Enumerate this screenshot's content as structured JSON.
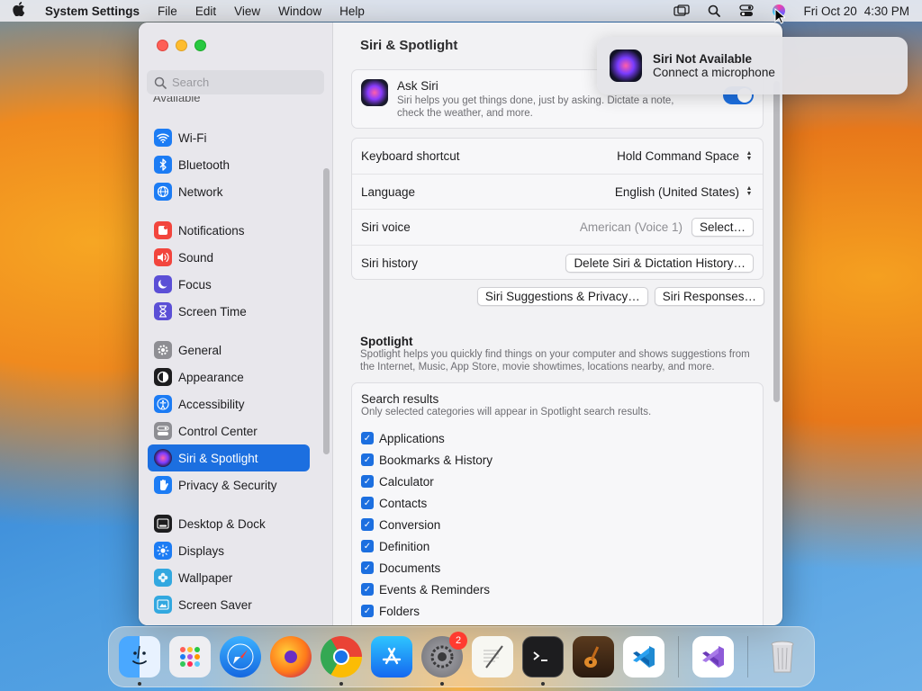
{
  "menubar": {
    "app_name": "System Settings",
    "menus": [
      "File",
      "Edit",
      "View",
      "Window",
      "Help"
    ],
    "date": "Fri Oct 20",
    "time": "4:30 PM"
  },
  "sidebar": {
    "search_placeholder": "Search",
    "cut_label": "Available",
    "items": [
      {
        "label": "Wi-Fi",
        "icon": "wifi-icon",
        "color": "#1c7cf4"
      },
      {
        "label": "Bluetooth",
        "icon": "bluetooth-icon",
        "color": "#1c7cf4"
      },
      {
        "label": "Network",
        "icon": "globe-icon",
        "color": "#1c7cf4"
      },
      {
        "label": "Notifications",
        "icon": "bell-icon",
        "color": "#f2453d"
      },
      {
        "label": "Sound",
        "icon": "speaker-icon",
        "color": "#f2453d"
      },
      {
        "label": "Focus",
        "icon": "moon-icon",
        "color": "#5b4fd6"
      },
      {
        "label": "Screen Time",
        "icon": "hourglass-icon",
        "color": "#5b4fd6"
      },
      {
        "label": "General",
        "icon": "gear-icon",
        "color": "#8e8e93"
      },
      {
        "label": "Appearance",
        "icon": "appearance-icon",
        "color": "#1d1d1f"
      },
      {
        "label": "Accessibility",
        "icon": "accessibility-icon",
        "color": "#1c7cf4"
      },
      {
        "label": "Control Center",
        "icon": "control-center-icon",
        "color": "#8e8e93"
      },
      {
        "label": "Siri & Spotlight",
        "icon": "siri-icon",
        "color": "#2a1b4a"
      },
      {
        "label": "Privacy & Security",
        "icon": "hand-icon",
        "color": "#1c7cf4"
      },
      {
        "label": "Desktop & Dock",
        "icon": "dock-icon",
        "color": "#1d1d1f"
      },
      {
        "label": "Displays",
        "icon": "sun-icon",
        "color": "#1c7cf4"
      },
      {
        "label": "Wallpaper",
        "icon": "flower-icon",
        "color": "#32a8e0"
      },
      {
        "label": "Screen Saver",
        "icon": "screensaver-icon",
        "color": "#32a8e0"
      }
    ]
  },
  "main": {
    "title": "Siri & Spotlight",
    "ask_siri": {
      "label": "Ask Siri",
      "description": "Siri helps you get things done, just by asking. Dictate a note, check the weather, and more.",
      "enabled": true
    },
    "keyboard_shortcut": {
      "label": "Keyboard shortcut",
      "value": "Hold Command Space"
    },
    "language": {
      "label": "Language",
      "value": "English (United States)"
    },
    "siri_voice": {
      "label": "Siri voice",
      "value": "American (Voice 1)",
      "button": "Select…"
    },
    "siri_history": {
      "label": "Siri history",
      "button": "Delete Siri & Dictation History…"
    },
    "suggestions_button": "Siri Suggestions & Privacy…",
    "responses_button": "Siri Responses…",
    "spotlight": {
      "title": "Spotlight",
      "description": "Spotlight helps you quickly find things on your computer and shows suggestions from the Internet, Music, App Store, movie showtimes, locations nearby, and more."
    },
    "search_results": {
      "title": "Search results",
      "description": "Only selected categories will appear in Spotlight search results.",
      "items": [
        "Applications",
        "Bookmarks & History",
        "Calculator",
        "Contacts",
        "Conversion",
        "Definition",
        "Documents",
        "Events & Reminders",
        "Folders"
      ]
    }
  },
  "notification": {
    "title": "Siri Not Available",
    "subtitle": "Connect a microphone"
  },
  "dock": {
    "apps": [
      {
        "name": "finder-icon",
        "color": "#2a8cf0",
        "running": true
      },
      {
        "name": "launchpad-icon",
        "color": "#e8e8ee",
        "running": false
      },
      {
        "name": "safari-icon",
        "color": "#1a8af0",
        "running": false
      },
      {
        "name": "firefox-icon",
        "color": "#ff7a1a",
        "running": false
      },
      {
        "name": "chrome-icon",
        "color": "#ffffff",
        "running": true
      },
      {
        "name": "app-store-icon",
        "color": "#1a8cf0",
        "running": false
      },
      {
        "name": "system-settings-icon",
        "color": "#8e8e93",
        "running": true,
        "badge": "2"
      },
      {
        "name": "textedit-icon",
        "color": "#f5f5f5",
        "running": false
      },
      {
        "name": "terminal-icon",
        "color": "#1d1d1f",
        "running": true
      },
      {
        "name": "garageband-icon",
        "color": "#3a2a1a",
        "running": false
      },
      {
        "name": "vscode-icon",
        "color": "#ffffff",
        "running": false
      },
      {
        "name": "visual-studio-icon",
        "color": "#ffffff",
        "running": false
      },
      {
        "name": "trash-icon",
        "color": "#dcdce0",
        "running": false
      }
    ]
  }
}
